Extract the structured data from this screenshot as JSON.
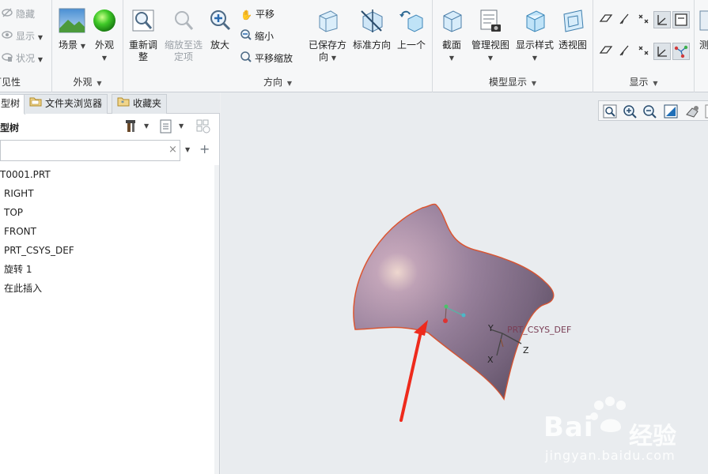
{
  "ribbon": {
    "visibility": {
      "title": "可见性",
      "items": [
        {
          "label": "隐藏",
          "icon": "hide-icon"
        },
        {
          "label": "显示",
          "icon": "show-icon"
        },
        {
          "label": "状况",
          "icon": "status-icon"
        }
      ]
    },
    "appearance": {
      "title": "外观",
      "items": [
        {
          "label": "场景",
          "icon": "scene-icon"
        },
        {
          "label": "外观",
          "icon": "appearance-sphere-icon"
        }
      ]
    },
    "orientation": {
      "title": "方向",
      "large": [
        {
          "label_line1": "重新调",
          "label_line2": "整",
          "icon": "refit-icon",
          "enabled": true
        },
        {
          "label_line1": "缩放至选",
          "label_line2": "定项",
          "icon": "zoom-to-selected-icon",
          "enabled": false
        },
        {
          "label_line1": "放大",
          "label_line2": "",
          "icon": "zoom-in-icon",
          "enabled": true
        }
      ],
      "small": [
        {
          "label": "平移",
          "icon": "pan-hand-icon"
        },
        {
          "label": "缩小",
          "icon": "zoom-out-icon"
        },
        {
          "label": "平移缩放",
          "icon": "pan-zoom-icon"
        }
      ],
      "large2": [
        {
          "label_line1": "已保存方",
          "label_line2": "向",
          "icon": "saved-orientation-icon"
        },
        {
          "label_line1": "标准方向",
          "label_line2": "",
          "icon": "standard-orientation-icon"
        },
        {
          "label_line1": "上一个",
          "label_line2": "",
          "icon": "previous-view-icon"
        }
      ]
    },
    "model_display": {
      "title": "模型显示",
      "items": [
        {
          "label": "截面",
          "icon": "section-icon"
        },
        {
          "label": "管理视图",
          "icon": "manage-views-icon"
        },
        {
          "label": "显示样式",
          "icon": "display-style-icon"
        },
        {
          "label": "透视图",
          "icon": "perspective-icon"
        }
      ]
    },
    "display": {
      "title": "显示",
      "icons": [
        "plane-display-icon",
        "axis-display-icon",
        "point-display-icon",
        "csys-display-icon",
        "annotation-display-icon",
        "plane-tag-icon",
        "axis-tag-icon",
        "point-tag-icon",
        "csys-tag-icon",
        "spin-center-icon"
      ]
    },
    "overflow": {
      "label": "测"
    }
  },
  "left_panel": {
    "tabs": [
      {
        "label": "型树",
        "icon": "model-tree-tab-icon"
      },
      {
        "label": "文件夹浏览器",
        "icon": "folder-icon"
      },
      {
        "label": "收藏夹",
        "icon": "favorites-icon"
      }
    ],
    "tree_title": "型树",
    "search": {
      "placeholder": "",
      "clear": "×"
    },
    "tree_items": [
      "T0001.PRT",
      "RIGHT",
      "TOP",
      "FRONT",
      "PRT_CSYS_DEF",
      "旋转 1",
      "在此插入"
    ]
  },
  "graphics": {
    "csys_label": "PRT_CSYS_DEF",
    "axis_x": "X",
    "axis_y": "Y",
    "axis_z": "Z",
    "surface_color": "#a08aa6",
    "edge_color": "#e0522a",
    "arrow_color": "#ee2a1c"
  },
  "watermark": {
    "brand": "Bai",
    "brand2": "经验",
    "url": "jingyan.baidu.com"
  }
}
